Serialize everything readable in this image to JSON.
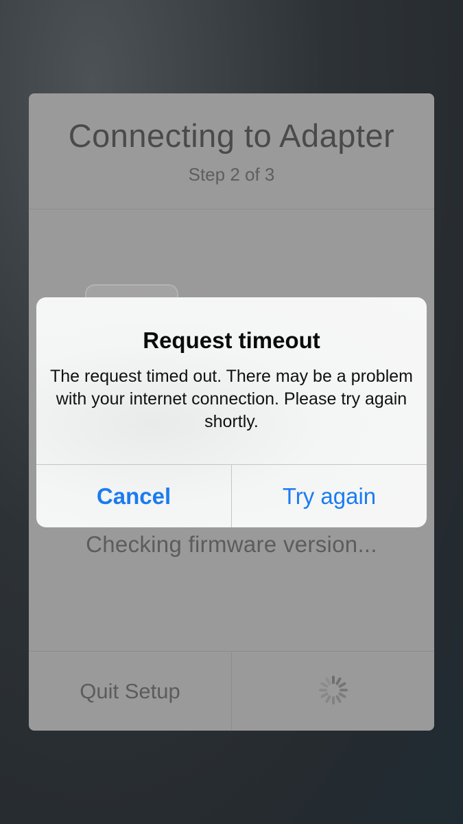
{
  "setup": {
    "title": "Connecting to Adapter",
    "step": "Step 2 of 3",
    "status": "Checking firmware version...",
    "quit_label": "Quit Setup",
    "spinner_icon": "activity-spinner-icon"
  },
  "alert": {
    "title": "Request timeout",
    "message": "The request timed out. There may be a problem with your internet connection. Please try again shortly.",
    "cancel_label": "Cancel",
    "retry_label": "Try again",
    "button_color": "#1a7cf0"
  }
}
